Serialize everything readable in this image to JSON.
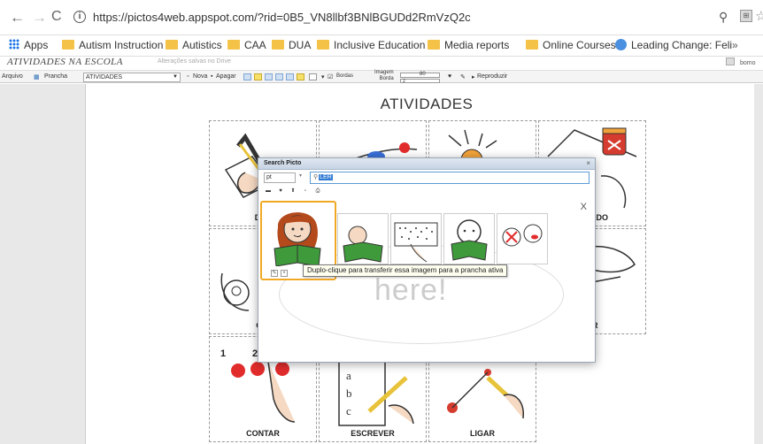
{
  "browser": {
    "url": "https://pictos4web.appspot.com/?rid=0B5_VN8llbf3BNlBGUDd2RmVzQ2c",
    "bookmarks": [
      {
        "label": "Apps",
        "icon": "apps-grid-icon"
      },
      {
        "label": "Autism Instruction",
        "icon": "folder-icon"
      },
      {
        "label": "Autistics",
        "icon": "folder-icon"
      },
      {
        "label": "CAA",
        "icon": "folder-icon"
      },
      {
        "label": "DUA",
        "icon": "folder-icon"
      },
      {
        "label": "Inclusive Education",
        "icon": "folder-icon"
      },
      {
        "label": "Media reports",
        "icon": "folder-icon"
      },
      {
        "label": "Online Courses",
        "icon": "folder-icon"
      },
      {
        "label": "Leading Change: Feli",
        "icon": "globe-icon"
      }
    ],
    "bookmarks_more": "»"
  },
  "app": {
    "title": "ATIVIDADES NA ESCOLA",
    "status": "Alterações salvas no Drive",
    "right": "bomo"
  },
  "toolbar": {
    "arquivo": "Arquivo",
    "prancha": "Prancha",
    "board_select": "ATIVIDADES",
    "nova": "Nova",
    "apagar": "Apagar",
    "bordas": "Bordas",
    "imagem": "Imagem",
    "borda": "Borda",
    "imagem_value": "80",
    "borda_value": "2",
    "reproduzir": "Reproduzir"
  },
  "board": {
    "title": "ATIVIDADES",
    "cells": [
      "DES",
      "",
      "",
      "M DEDO",
      "CIR",
      "",
      "",
      "AR",
      "CONTAR",
      "ESCREVER",
      "LIGAR",
      ""
    ]
  },
  "search_dialog": {
    "title": "Search Picto",
    "close": "×",
    "language": "pt",
    "query": "LER",
    "results_close": "X",
    "watermark": "here!",
    "tooltip": "Duplo-clique para transferir essa imagem para a prancha ativa"
  }
}
